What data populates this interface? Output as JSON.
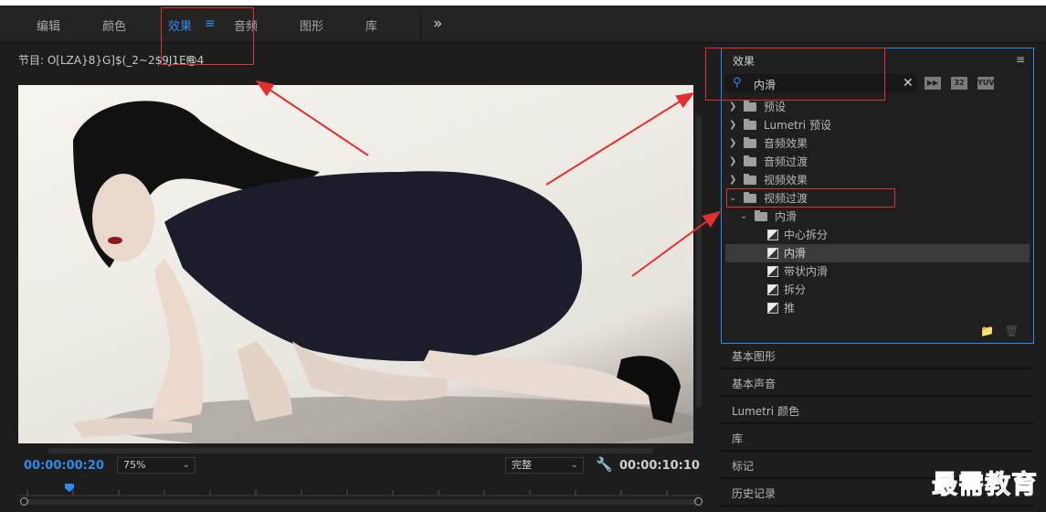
{
  "topbar": {
    "tabs": [
      {
        "label": "编辑"
      },
      {
        "label": "颜色"
      },
      {
        "label": "效果"
      },
      {
        "label": "音频"
      },
      {
        "label": "图形"
      },
      {
        "label": "库"
      }
    ],
    "active_tab": "效果",
    "overflow": "»",
    "menu_glyph": "≡"
  },
  "program_monitor": {
    "title": "节目: O[LZA}8}G]$(_2~2$9J1E@4",
    "menu_glyph": "≡",
    "timecode_current": "00:00:00:20",
    "zoom": "75%",
    "resolution": "完整",
    "timecode_duration": "00:00:10:10"
  },
  "effects_panel": {
    "title": "效果",
    "menu_glyph": "≡",
    "search_value": "内滑",
    "badges": [
      "32",
      "YUV"
    ],
    "tree": [
      {
        "label": "预设",
        "depth": 0,
        "expanded": false,
        "type": "preset-folder"
      },
      {
        "label": "Lumetri 预设",
        "depth": 0,
        "expanded": false,
        "type": "preset-folder"
      },
      {
        "label": "音频效果",
        "depth": 0,
        "expanded": false,
        "type": "folder"
      },
      {
        "label": "音频过渡",
        "depth": 0,
        "expanded": false,
        "type": "folder"
      },
      {
        "label": "视频效果",
        "depth": 0,
        "expanded": false,
        "type": "folder"
      },
      {
        "label": "视频过渡",
        "depth": 0,
        "expanded": true,
        "type": "folder"
      },
      {
        "label": "内滑",
        "depth": 1,
        "expanded": true,
        "type": "folder"
      },
      {
        "label": "中心拆分",
        "depth": 2,
        "type": "effect"
      },
      {
        "label": "内滑",
        "depth": 2,
        "type": "effect",
        "selected": true
      },
      {
        "label": "带状内滑",
        "depth": 2,
        "type": "effect"
      },
      {
        "label": "拆分",
        "depth": 2,
        "type": "effect"
      },
      {
        "label": "推",
        "depth": 2,
        "type": "effect"
      }
    ]
  },
  "side_panels": [
    {
      "label": "基本图形"
    },
    {
      "label": "基本声音"
    },
    {
      "label": "Lumetri 颜色"
    },
    {
      "label": "库"
    },
    {
      "label": "标记"
    },
    {
      "label": "历史记录"
    }
  ],
  "watermark": "最需教育",
  "colors": {
    "accent": "#2d8ceb",
    "annotation": "#e03030"
  }
}
